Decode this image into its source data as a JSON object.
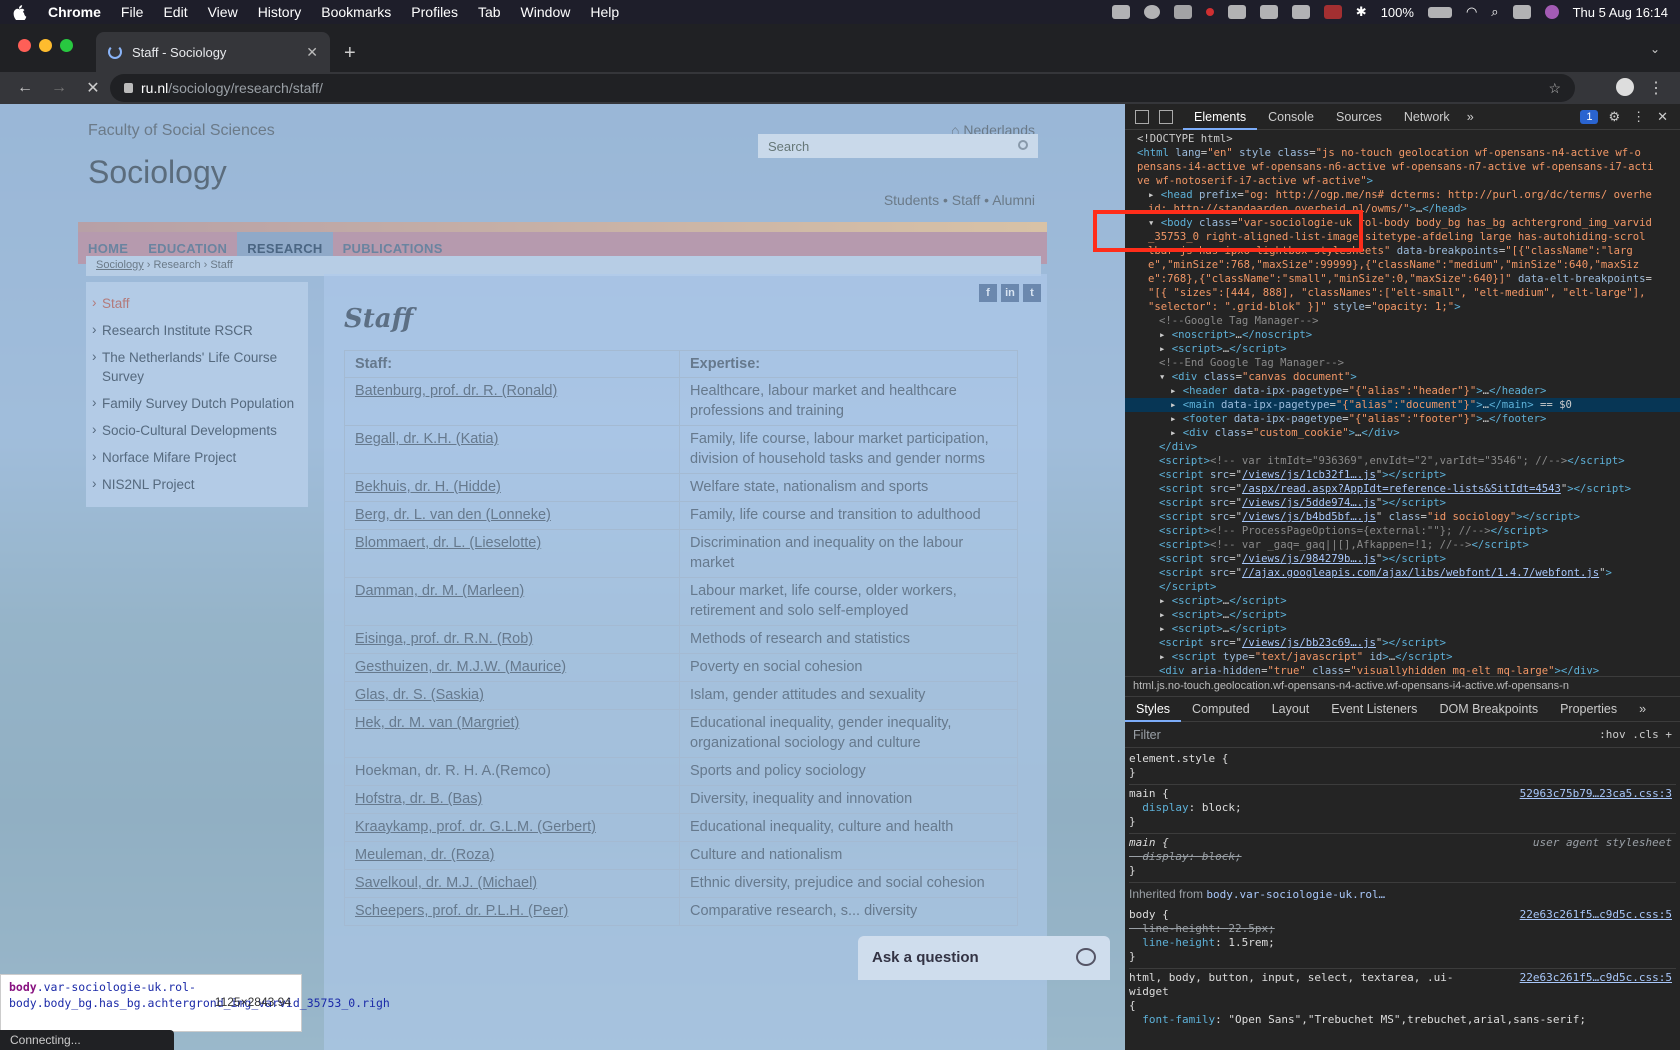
{
  "menubar": {
    "app": "Chrome",
    "items": [
      "File",
      "Edit",
      "View",
      "History",
      "Bookmarks",
      "Profiles",
      "Tab",
      "Window",
      "Help"
    ],
    "battery": "100%",
    "datetime": "Thu 5 Aug  16:14"
  },
  "browser": {
    "tab_title": "Staff - Sociology",
    "url_host": "ru.nl",
    "url_path": "/sociology/research/staff/",
    "status": "Connecting..."
  },
  "site": {
    "faculty": "Faculty of Social Sciences",
    "home_link": "Nederlands",
    "search_placeholder": "Search",
    "title": "Sociology",
    "audience": "Students • Staff • Alumni",
    "nav": [
      "HOME",
      "EDUCATION",
      "RESEARCH",
      "PUBLICATIONS"
    ],
    "breadcrumb": [
      "Sociology",
      "Research",
      "Staff"
    ],
    "sidebar": [
      "Staff",
      "Research Institute RSCR",
      "The Netherlands' Life Course Survey",
      "Family Survey Dutch Population",
      "Socio-Cultural Developments",
      "Norface Mifare Project",
      "NIS2NL Project"
    ],
    "social": [
      "f",
      "in",
      "t"
    ],
    "heading": "Staff",
    "table": {
      "headers": [
        "Staff:",
        "Expertise:"
      ],
      "rows": [
        {
          "name": "Batenburg, prof. dr. R. (Ronald)",
          "expertise": "Healthcare, labour market and healthcare professions and training"
        },
        {
          "name": "Begall, dr. K.H. (Katia)",
          "expertise": "Family, life course, labour market participation, division of household tasks and gender norms"
        },
        {
          "name": "Bekhuis, dr. H. (Hidde)",
          "expertise": "Welfare state, nationalism and sports"
        },
        {
          "name": "Berg, dr. L. van den (Lonneke)",
          "expertise": "Family, life course and transition to adulthood"
        },
        {
          "name": "Blommaert, dr. L. (Lieselotte)",
          "expertise": "Discrimination and inequality on the labour market"
        },
        {
          "name": "Damman, dr. M. (Marleen)",
          "expertise": "Labour market, life course, older workers, retirement and solo self-employed"
        },
        {
          "name": "Eisinga, prof. dr. R.N. (Rob)",
          "expertise": "Methods of research and statistics"
        },
        {
          "name": "Gesthuizen, dr. M.J.W. (Maurice)",
          "expertise": "Poverty en social cohesion"
        },
        {
          "name": "Glas, dr. S. (Saskia)",
          "expertise": "Islam, gender attitudes and sexuality"
        },
        {
          "name": "Hek, dr. M. van (Margriet)",
          "expertise": "Educational inequality, gender inequality, organizational sociology and culture"
        },
        {
          "name": "Hoekman, dr. R. H. A.(Remco)",
          "expertise": "Sports and policy sociology"
        },
        {
          "name": "Hofstra, dr. B. (Bas)",
          "expertise": "Diversity, inequality and innovation"
        },
        {
          "name": "Kraaykamp, prof. dr. G.L.M. (Gerbert)",
          "expertise": "Educational inequality, culture and health"
        },
        {
          "name": "Meuleman, dr. (Roza)",
          "expertise": "Culture and nationalism"
        },
        {
          "name": "Savelkoul, dr. M.J. (Michael)",
          "expertise": "Ethnic diversity, prejudice and social cohesion"
        },
        {
          "name": "Scheepers, prof. dr. P.L.H. (Peer)",
          "expertise": "Comparative research, s... diversity"
        }
      ]
    },
    "ask": "Ask a question"
  },
  "tooltip": {
    "tag": "body",
    "selector": ".var-sociologie-uk.rol-body.body_bg.has_bg.achtergrond_img_varvid_35753_0.righ",
    "dims": "1125×2843.94"
  },
  "devtools": {
    "tabs": [
      "Elements",
      "Console",
      "Sources",
      "Network"
    ],
    "badge": "1",
    "dom": [
      {
        "i": 0,
        "html": "&lt;!DOCTYPE html&gt;"
      },
      {
        "i": 0,
        "html": "<span class='tag'>&lt;html</span> <span class='attr'>lang</span>=<span class='val'>\"en\"</span> <span class='attr'>style class</span>=<span class='val'>\"js no-touch geolocation wf-opensans-n4-active wf-o</span>"
      },
      {
        "i": 0,
        "html": "<span class='val'>pensans-i4-active wf-opensans-n6-active wf-opensans-n7-active wf-opensans-i7-acti</span>"
      },
      {
        "i": 0,
        "html": "<span class='val'>ve wf-notoserif-i7-active wf-active\"</span><span class='tag'>&gt;</span>"
      },
      {
        "i": 1,
        "html": "▸ <span class='tag'>&lt;head</span> <span class='attr'>prefix</span>=<span class='val'>\"og: http://ogp.me/ns# dcterms: http://purl.org/dc/terms/ overhe</span>"
      },
      {
        "i": 1,
        "html": "<span class='val'>  id: http://standaarden.overheid.nl/owms/\"</span><span class='tag'>&gt;</span>…<span class='tag'>&lt;/head&gt;</span>"
      },
      {
        "i": 1,
        "html": "▾ <span class='tag'>&lt;body</span> <span class='attr'>class</span>=<span class='val'>\"var-sociologie-uk rol-body body_bg has_bg achtergrond_img_varvid</span>"
      },
      {
        "i": 1,
        "html": "<span class='val'>_35753_0 right-aligned-list-image sitetype-afdeling large has-autohiding-scrol</span>"
      },
      {
        "i": 1,
        "html": "<span class='val'>lbar js has-ipxo-lightbox-stylesheets\"</span> <span class='attr'>data-breakpoints</span>=<span class='val'>\"[{\"className\":\"larg</span>"
      },
      {
        "i": 1,
        "html": "<span class='val'>e\",\"minSize\":768,\"maxSize\":99999},{\"className\":\"medium\",\"minSize\":640,\"maxSiz</span>"
      },
      {
        "i": 1,
        "html": "<span class='val'>e\":768},{\"className\":\"small\",\"minSize\":0,\"maxSize\":640}]\"</span> <span class='attr'>data-elt-breakpoints</span>="
      },
      {
        "i": 1,
        "html": "<span class='val'>\"[{ \"sizes\":[444, 888], \"classNames\":[\"elt-small\", \"elt-medium\", \"elt-large\"],</span>"
      },
      {
        "i": 1,
        "html": "<span class='val'>\"selector\": \".grid-blok\" }]\"</span> <span class='attr'>style</span>=<span class='val'>\"opacity: 1;\"</span><span class='tag'>&gt;</span>"
      },
      {
        "i": 2,
        "html": "<span class='cmt'>&lt;!--Google Tag Manager--&gt;</span>"
      },
      {
        "i": 2,
        "html": "▸ <span class='tag'>&lt;noscript&gt;</span>…<span class='tag'>&lt;/noscript&gt;</span>"
      },
      {
        "i": 2,
        "html": "▸ <span class='tag'>&lt;script&gt;</span>…<span class='tag'>&lt;/script&gt;</span>"
      },
      {
        "i": 2,
        "html": "<span class='cmt'>&lt;!--End Google Tag Manager--&gt;</span>"
      },
      {
        "i": 2,
        "html": "▾ <span class='tag'>&lt;div</span> <span class='attr'>class</span>=<span class='val'>\"canvas document\"</span><span class='tag'>&gt;</span>"
      },
      {
        "i": 3,
        "html": "▸ <span class='tag'>&lt;header</span> <span class='attr'>data-ipx-pagetype</span>=<span class='val'>\"{\"alias\":\"header\"}\"</span><span class='tag'>&gt;</span>…<span class='tag'>&lt;/header&gt;</span>"
      },
      {
        "i": 3,
        "sel": true,
        "html": "▸ <span class='tag'>&lt;main</span> <span class='attr'>data-ipx-pagetype</span>=<span class='val'>\"{\"alias\":\"document\"}\"</span><span class='tag'>&gt;</span>…<span class='tag'>&lt;/main&gt;</span> == $0"
      },
      {
        "i": 3,
        "html": "▸ <span class='tag'>&lt;footer</span> <span class='attr'>data-ipx-pagetype</span>=<span class='val'>\"{\"alias\":\"footer\"}\"</span><span class='tag'>&gt;</span>…<span class='tag'>&lt;/footer&gt;</span>"
      },
      {
        "i": 3,
        "html": "▸ <span class='tag'>&lt;div</span> <span class='attr'>class</span>=<span class='val'>\"custom_cookie\"</span><span class='tag'>&gt;</span>…<span class='tag'>&lt;/div&gt;</span>"
      },
      {
        "i": 2,
        "html": "<span class='tag'>&lt;/div&gt;</span>"
      },
      {
        "i": 2,
        "html": "<span class='tag'>&lt;script&gt;</span><span class='cmt'>&lt;!-- var itmIdt=\"936369\",envIdt=\"2\",varIdt=\"3546\"; //--&gt;</span><span class='tag'>&lt;/script&gt;</span>"
      },
      {
        "i": 2,
        "html": "<span class='tag'>&lt;script</span> <span class='attr'>src</span>=\"<span class='url'>/views/js/1cb32f1….js</span>\"<span class='tag'>&gt;&lt;/script&gt;</span>"
      },
      {
        "i": 2,
        "html": "<span class='tag'>&lt;script</span> <span class='attr'>src</span>=\"<span class='url'>/aspx/read.aspx?AppIdt=reference-lists&amp;SitIdt=4543</span>\"<span class='tag'>&gt;&lt;/script&gt;</span>"
      },
      {
        "i": 2,
        "html": "<span class='tag'>&lt;script</span> <span class='attr'>src</span>=\"<span class='url'>/views/js/5dde974….js</span>\"<span class='tag'>&gt;&lt;/script&gt;</span>"
      },
      {
        "i": 2,
        "html": "<span class='tag'>&lt;script</span> <span class='attr'>src</span>=\"<span class='url'>/views/js/b4bd5bf….js</span>\" <span class='attr'>class</span>=<span class='val'>\"id sociology\"</span><span class='tag'>&gt;&lt;/script&gt;</span>"
      },
      {
        "i": 2,
        "html": "<span class='tag'>&lt;script&gt;</span><span class='cmt'>&lt;!-- ProcessPageOptions={external:\"\"}; //--&gt;</span><span class='tag'>&lt;/script&gt;</span>"
      },
      {
        "i": 2,
        "html": "<span class='tag'>&lt;script&gt;</span><span class='cmt'>&lt;!-- var _gaq=_gaq||[],Afkappen=!1; //--&gt;</span><span class='tag'>&lt;/script&gt;</span>"
      },
      {
        "i": 2,
        "html": "<span class='tag'>&lt;script</span> <span class='attr'>src</span>=\"<span class='url'>/views/js/984279b….js</span>\"<span class='tag'>&gt;&lt;/script&gt;</span>"
      },
      {
        "i": 2,
        "html": "<span class='tag'>&lt;script</span> <span class='attr'>src</span>=\"<span class='url'>//ajax.googleapis.com/ajax/libs/webfont/1.4.7/webfont.js</span>\"<span class='tag'>&gt;</span>"
      },
      {
        "i": 2,
        "html": "<span class='tag'>&lt;/script&gt;</span>"
      },
      {
        "i": 2,
        "html": "▸ <span class='tag'>&lt;script&gt;</span>…<span class='tag'>&lt;/script&gt;</span>"
      },
      {
        "i": 2,
        "html": "▸ <span class='tag'>&lt;script&gt;</span>…<span class='tag'>&lt;/script&gt;</span>"
      },
      {
        "i": 2,
        "html": "▸ <span class='tag'>&lt;script&gt;</span>…<span class='tag'>&lt;/script&gt;</span>"
      },
      {
        "i": 2,
        "html": "<span class='tag'>&lt;script</span> <span class='attr'>src</span>=\"<span class='url'>/views/js/bb23c69….js</span>\"<span class='tag'>&gt;&lt;/script&gt;</span>"
      },
      {
        "i": 2,
        "html": "▸ <span class='tag'>&lt;script</span> <span class='attr'>type</span>=<span class='val'>\"text/javascript\"</span> <span class='attr'>id</span><span class='tag'>&gt;</span>…<span class='tag'>&lt;/script&gt;</span>"
      },
      {
        "i": 2,
        "html": "<span class='tag'>&lt;div</span> <span class='attr'>aria-hidden</span>=<span class='val'>\"true\"</span> <span class='attr'>class</span>=<span class='val'>\"visuallyhidden mq-elt mq-large\"</span><span class='tag'>&gt;&lt;/div&gt;</span>"
      }
    ],
    "breadcrumb": "html.js.no-touch.geolocation.wf-opensans-n4-active.wf-opensans-i4-active.wf-opensans-n",
    "styles_tabs": [
      "Styles",
      "Computed",
      "Layout",
      "Event Listeners",
      "DOM Breakpoints",
      "Properties"
    ],
    "filter_placeholder": "Filter",
    "filter_tools": ":hov  .cls  +",
    "rules": {
      "element_style": "element.style {",
      "main_src": "52963c75b79…23ca5.css:3",
      "ua_label": "user agent stylesheet",
      "inherited_label": "Inherited from ",
      "inherited_link": "body.var-sociologie-uk.rol…",
      "body_src": "22e63c261f5…c9d5c.css:5",
      "body_lh_old": "22.5px",
      "body_lh_new": "1.5rem",
      "font_sel": "html, body, button, input, select, textarea, .ui-widget",
      "font_src": "22e63c261f5…c9d5c.css:5",
      "font_val": "\"Open Sans\",\"Trebuchet MS\",trebuchet,arial,sans-serif;"
    }
  }
}
